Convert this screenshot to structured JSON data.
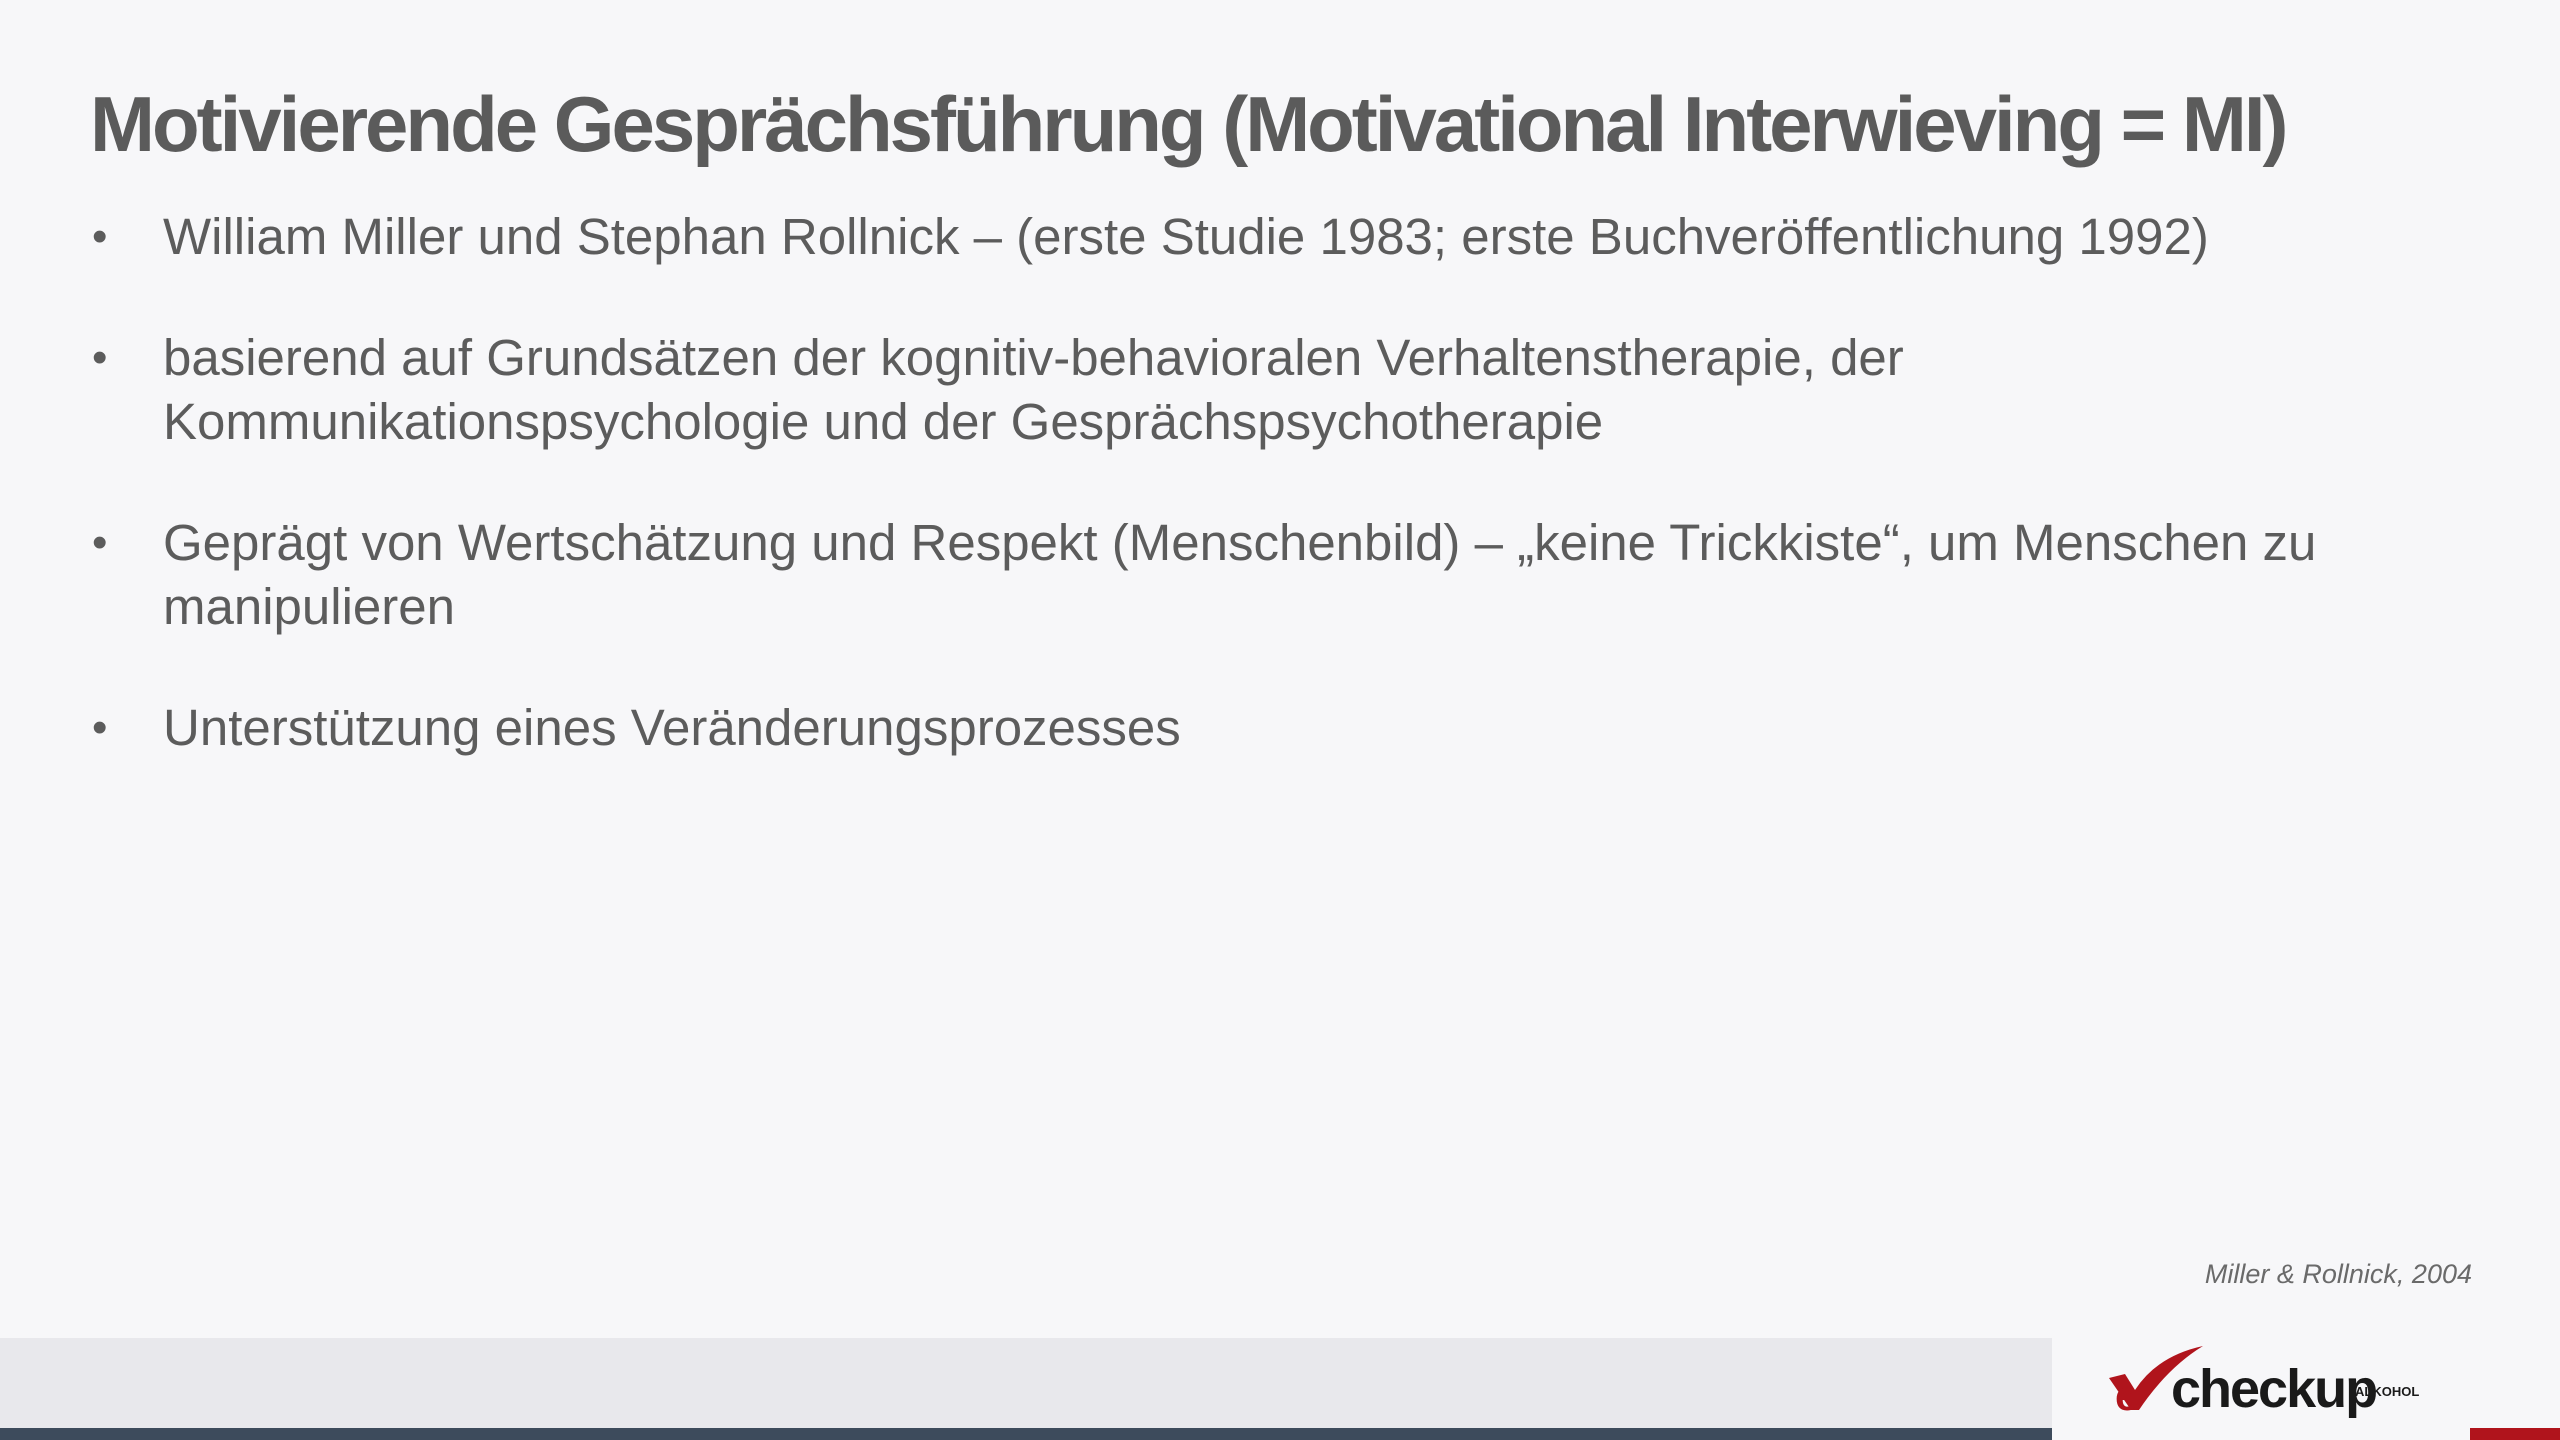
{
  "slide": {
    "title": "Motivierende Gesprächsführung (Motivational Interwieving = MI)",
    "bullets": [
      {
        "text": "William Miller und Stephan Rollnick – (erste Studie 1983; erste Buchveröffentlichung 1992)"
      },
      {
        "text": "basierend auf Grundsätzen der kognitiv-behavioralen Verhaltenstherapie, der Kommunikationspsychologie und der Gesprächspsychotherapie"
      },
      {
        "text": "Geprägt von Wertschätzung und Respekt  (Menschenbild) – „keine Trickkiste“, um Menschen zu manipulieren"
      },
      {
        "text": "Unterstützung eines Veränderungsprozesses"
      }
    ],
    "bullet_symbol": "•",
    "citation": "Miller & Rollnick, 2004"
  },
  "logo": {
    "word": "checkup",
    "subtext": "ALKOHOL",
    "icon": "red-check-e-icon",
    "colors": {
      "red": "#b0141c",
      "text": "#1a1a1a"
    }
  },
  "footer": {
    "colors": {
      "band": "#e8e8ec",
      "line_blue": "#3d4b5c",
      "line_red": "#b0141c"
    }
  }
}
